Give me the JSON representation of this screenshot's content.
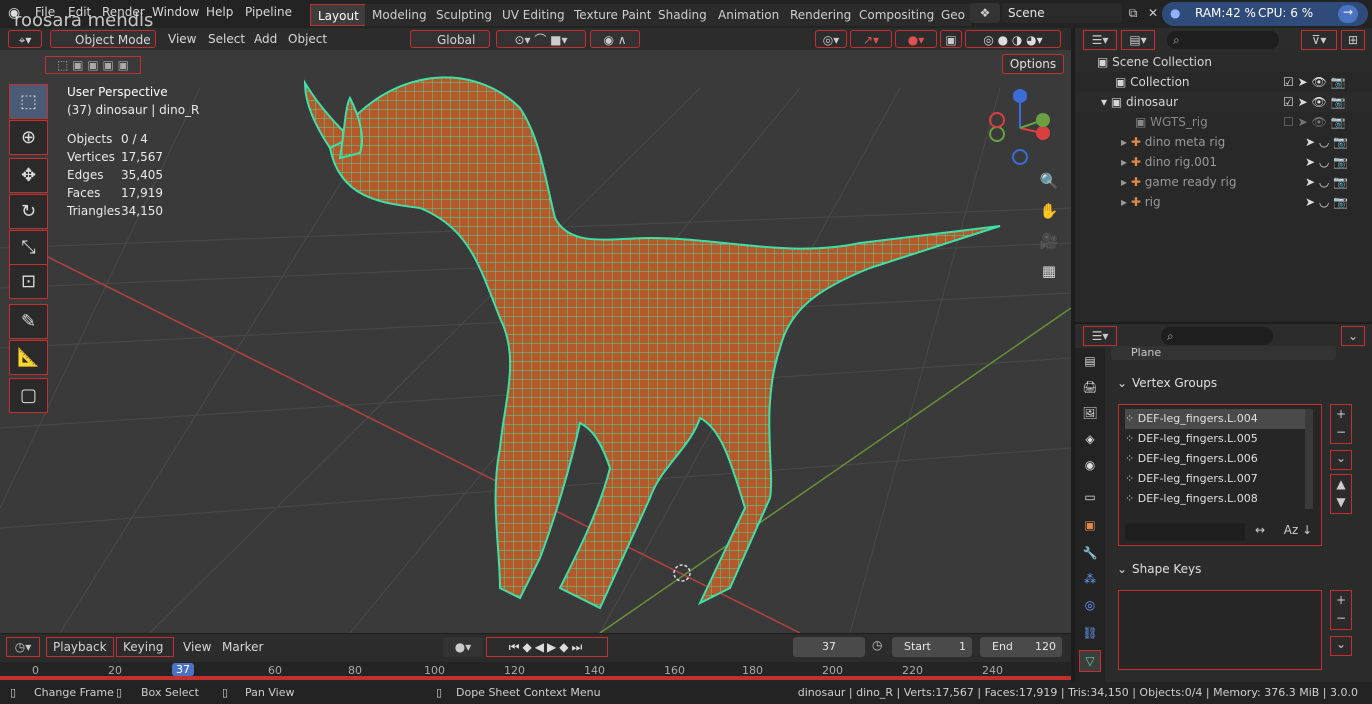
{
  "watermark": "roosara mendis",
  "menus": [
    "File",
    "Edit",
    "Render",
    "Window",
    "Help",
    "Pipeline"
  ],
  "workspaces": [
    "Layout",
    "Modeling",
    "Sculpting",
    "UV Editing",
    "Texture Paint",
    "Shading",
    "Animation",
    "Rendering",
    "Compositing",
    "Geo"
  ],
  "scene": {
    "label": "Scene"
  },
  "stats_top": {
    "ram": "RAM:42 %",
    "cpu": "CPU: 6 %"
  },
  "viewport_header": {
    "mode": "Object Mode",
    "view": "View",
    "select": "Select",
    "add": "Add",
    "object": "Object",
    "orientation": "Global",
    "options": "Options"
  },
  "viewport_info": {
    "perspective": "User Perspective",
    "context": "(37) dinosaur | dino_R"
  },
  "stats": [
    {
      "label": "Objects",
      "value": "0 / 4"
    },
    {
      "label": "Vertices",
      "value": "17,567"
    },
    {
      "label": "Edges",
      "value": "35,405"
    },
    {
      "label": "Faces",
      "value": "17,919"
    },
    {
      "label": "Triangles",
      "value": "34,150"
    }
  ],
  "outliner": {
    "root": "Scene Collection",
    "rows": [
      {
        "label": "Collection"
      },
      {
        "label": "dinosaur"
      },
      {
        "label": "WGTS_rig"
      },
      {
        "label": "dino meta rig"
      },
      {
        "label": "dino rig.001"
      },
      {
        "label": "game ready rig"
      },
      {
        "label": "rig"
      }
    ]
  },
  "properties": {
    "object_name": "Plane",
    "vertex_groups_title": "Vertex Groups",
    "vertex_groups": [
      "DEF-leg_fingers.L.004",
      "DEF-leg_fingers.L.005",
      "DEF-leg_fingers.L.006",
      "DEF-leg_fingers.L.007",
      "DEF-leg_fingers.L.008"
    ],
    "shape_keys_title": "Shape Keys"
  },
  "timeline": {
    "playback": "Playback",
    "keying": "Keying",
    "view": "View",
    "marker": "Marker",
    "current_frame": "37",
    "start_label": "Start",
    "start": "1",
    "end_label": "End",
    "end": "120",
    "ticks": [
      "0",
      "20",
      "37",
      "60",
      "80",
      "100",
      "120",
      "140",
      "160",
      "180",
      "200",
      "220",
      "240"
    ]
  },
  "status": {
    "change_frame": "Change Frame",
    "box_select": "Box Select",
    "pan_view": "Pan View",
    "context_menu": "Dope Sheet Context Menu",
    "info": "dinosaur | dino_R | Verts:17,567 | Faces:17,919 | Tris:34,150 | Objects:0/4 | Memory: 376.3 MiB | 3.0.0"
  },
  "colors": {
    "accent": "#c43030",
    "wire": "#3fe0a8",
    "body": "#b55a2a"
  }
}
